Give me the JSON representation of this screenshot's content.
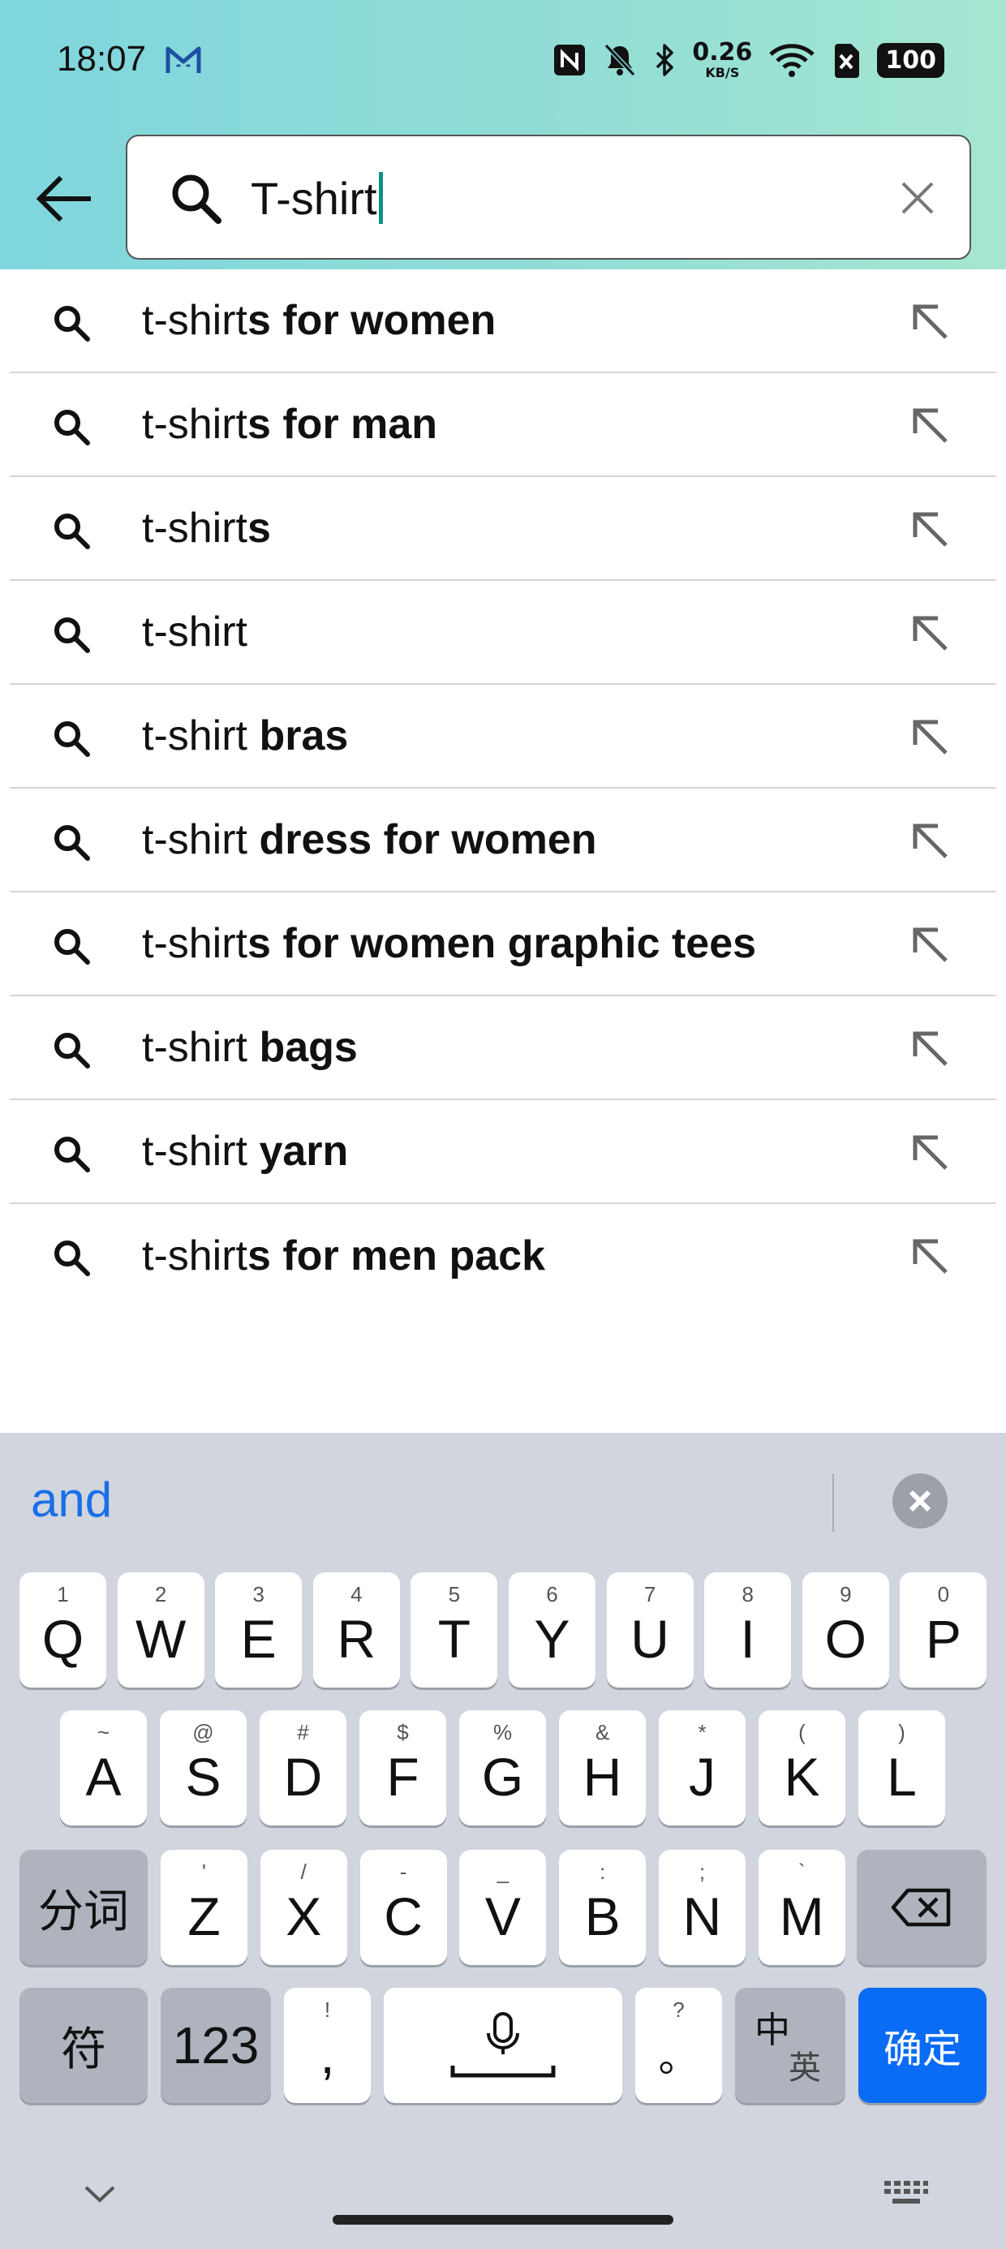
{
  "status_bar": {
    "time": "18:07",
    "net_speed_value": "0.26",
    "net_speed_unit": "KB/S",
    "battery": "100",
    "icons": [
      "gmail-icon",
      "nfc-icon",
      "mute-icon",
      "bluetooth-icon",
      "wifi-icon",
      "sim-off-icon"
    ]
  },
  "search": {
    "query": "T-shirt"
  },
  "suggestions": [
    {
      "prefix": "t-shirt",
      "bold": "s for women"
    },
    {
      "prefix": "t-shirt",
      "bold": "s for man"
    },
    {
      "prefix": "t-shirt",
      "bold": "s"
    },
    {
      "prefix": "t-shirt",
      "bold": ""
    },
    {
      "prefix": "t-shirt ",
      "bold": "bras"
    },
    {
      "prefix": "t-shirt ",
      "bold": "dress for women"
    },
    {
      "prefix": "t-shirt",
      "bold": "s for women graphic tees"
    },
    {
      "prefix": "t-shirt ",
      "bold": "bags"
    },
    {
      "prefix": "t-shirt ",
      "bold": "yarn"
    },
    {
      "prefix": "t-shirt",
      "bold": "s for men pack"
    }
  ],
  "keyboard": {
    "candidate": "and",
    "row1": [
      {
        "k": "Q",
        "h": "1"
      },
      {
        "k": "W",
        "h": "2"
      },
      {
        "k": "E",
        "h": "3"
      },
      {
        "k": "R",
        "h": "4"
      },
      {
        "k": "T",
        "h": "5"
      },
      {
        "k": "Y",
        "h": "6"
      },
      {
        "k": "U",
        "h": "7"
      },
      {
        "k": "I",
        "h": "8"
      },
      {
        "k": "O",
        "h": "9"
      },
      {
        "k": "P",
        "h": "0"
      }
    ],
    "row2": [
      {
        "k": "A",
        "h": "~"
      },
      {
        "k": "S",
        "h": "@"
      },
      {
        "k": "D",
        "h": "#"
      },
      {
        "k": "F",
        "h": "$"
      },
      {
        "k": "G",
        "h": "%"
      },
      {
        "k": "H",
        "h": "&"
      },
      {
        "k": "J",
        "h": "*"
      },
      {
        "k": "K",
        "h": "("
      },
      {
        "k": "L",
        "h": ")"
      }
    ],
    "row3": [
      {
        "k": "Z",
        "h": "'"
      },
      {
        "k": "X",
        "h": "/"
      },
      {
        "k": "C",
        "h": "-"
      },
      {
        "k": "V",
        "h": "_"
      },
      {
        "k": "B",
        "h": ":"
      },
      {
        "k": "N",
        "h": ";"
      },
      {
        "k": "M",
        "h": "`"
      }
    ],
    "segment_key": "分词",
    "symbol_key": "符",
    "num_key": "123",
    "comma_key": ",",
    "comma_hint": "!",
    "period_key": "。",
    "period_hint": "?",
    "lang_key_top": "中",
    "lang_key_bottom": "英",
    "confirm_key": "确定"
  }
}
